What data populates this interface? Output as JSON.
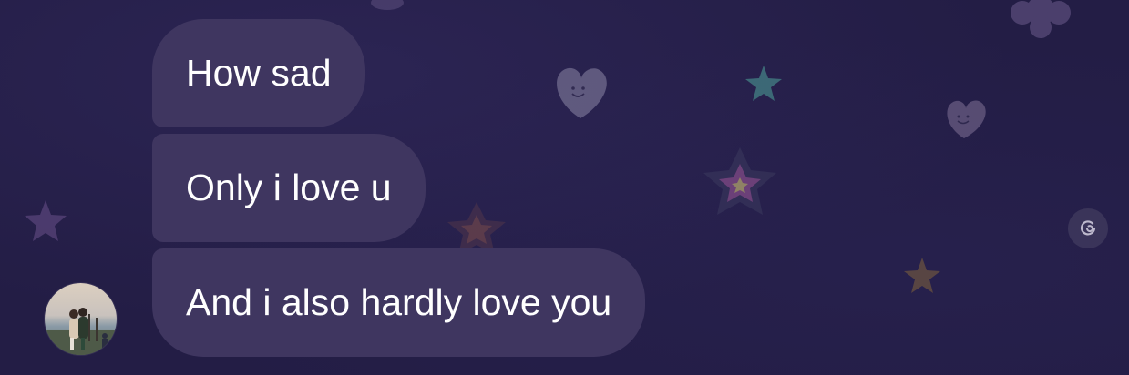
{
  "messages": [
    {
      "text": "How sad"
    },
    {
      "text": "Only i love u"
    },
    {
      "text": "And i also hardly love you"
    }
  ],
  "avatar": {
    "icon": "contact-avatar-photo"
  },
  "controls": {
    "refresh_icon": "refresh-icon"
  },
  "colors": {
    "background": "#231d45",
    "bubble": "#3f3660",
    "text": "#ffffff"
  }
}
